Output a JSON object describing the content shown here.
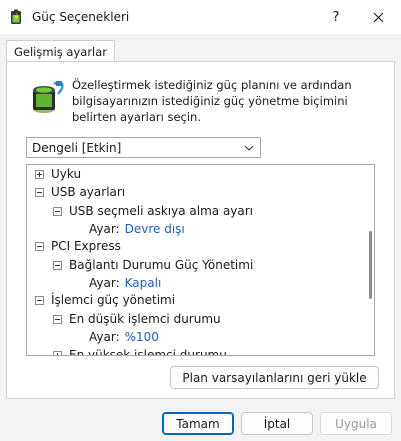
{
  "window": {
    "title": "Güç Seçenekleri",
    "help_glyph": "?",
    "close_glyph": "✕"
  },
  "tabs": [
    {
      "label": "Gelişmiş ayarlar",
      "selected": true
    }
  ],
  "description": "Özelleştirmek istediğiniz güç planını ve ardından bilgisayarınızın istediğiniz güç yönetme biçimini belirten ayarları seçin.",
  "plan_select": {
    "selected": "Dengeli [Etkin]"
  },
  "tree": {
    "items": [
      {
        "label": "Uyku",
        "level": 0,
        "toggle": "plus"
      },
      {
        "label": "USB ayarları",
        "level": 0,
        "toggle": "minus"
      },
      {
        "label": "USB seçmeli askıya alma ayarı",
        "level": 1,
        "toggle": "minus"
      },
      {
        "label": "Ayar:",
        "value": "Devre dışı",
        "level": 2
      },
      {
        "label": "PCI Express",
        "level": 0,
        "toggle": "minus"
      },
      {
        "label": "Bağlantı Durumu Güç Yönetimi",
        "level": 1,
        "toggle": "minus"
      },
      {
        "label": "Ayar:",
        "value": "Kapalı",
        "level": 2
      },
      {
        "label": "İşlemci güç yönetimi",
        "level": 0,
        "toggle": "minus"
      },
      {
        "label": "En düşük işlemci durumu",
        "level": 1,
        "toggle": "minus"
      },
      {
        "label": "Ayar:",
        "value": "%100",
        "level": 2
      },
      {
        "label": "En yüksek işlemci durumu",
        "level": 1,
        "toggle": "plus"
      }
    ]
  },
  "buttons": {
    "restore": "Plan varsayılanlarını geri yükle",
    "ok": "Tamam",
    "cancel": "İptal",
    "apply": "Uygula"
  },
  "colors": {
    "value_link": "#1f5fbf",
    "default_button_border": "#0067c0"
  }
}
